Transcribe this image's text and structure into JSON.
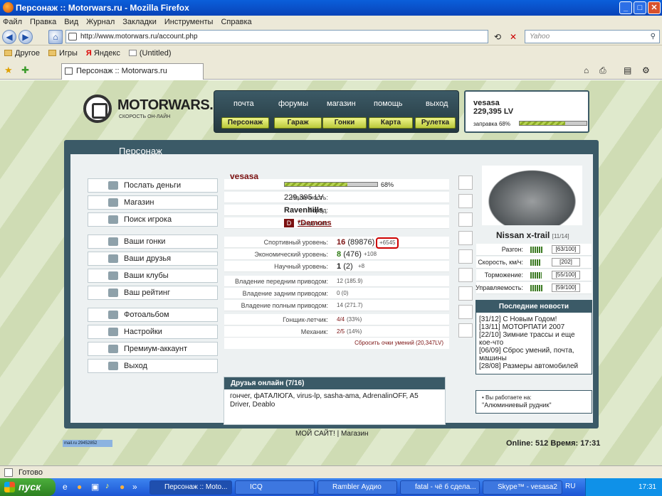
{
  "window": {
    "title": "Персонаж :: Motorwars.ru - Mozilla Firefox"
  },
  "menu": [
    "Файл",
    "Правка",
    "Вид",
    "Журнал",
    "Закладки",
    "Инструменты",
    "Справка"
  ],
  "nav": {
    "url": "http://www.motorwars.ru/account.php",
    "search_placeholder": "Yahoo"
  },
  "bookmarks": [
    "Другое",
    "Игры",
    "Яндекс",
    "(Untitled)"
  ],
  "tab": {
    "label": "Персонаж :: Motorwars.ru"
  },
  "site": {
    "logo": "MOTORWARS.RU",
    "logo_sub": "СКОРОСТЬ ОН-ЛАЙН",
    "top_links": [
      "почта",
      "форумы",
      "магазин",
      "помощь",
      "выход"
    ],
    "top_buttons": [
      "Персонаж",
      "Гараж",
      "Гонки",
      "Карта",
      "Рулетка"
    ],
    "user": {
      "name": "vesasa",
      "money": "229,395 LV",
      "fuel_label": "заправка 68%",
      "fuel_pct": 68
    },
    "section_title": "Персонаж",
    "menu": [
      "Послать деньги",
      "Магазин",
      "Поиск игрока",
      "Ваши гонки",
      "Ваши друзья",
      "Ваши клубы",
      "Ваш рейтинг",
      "Фотоальбом",
      "Настройки",
      "Премиум-аккаунт",
      "Выход"
    ],
    "char_name": "vesasa",
    "rows": {
      "fuel_label": "Заправка:",
      "fuel_val": "68%",
      "cash_label": "Наличность:",
      "cash_val": "229,395 LV",
      "city_label": "Город:",
      "city_val": "Ravenhills",
      "synd_label": "Синдикат:",
      "synd_val": "*Demons",
      "sport_label": "Спортивный уровень:",
      "sport_lvl": "16",
      "sport_pts": "(89876)",
      "sport_add": "+6545",
      "eco_label": "Экономический уровень:",
      "eco_lvl": "8",
      "eco_pts": "(476)",
      "eco_add": "+108",
      "sci_label": "Научный уровень:",
      "sci_lvl": "1",
      "sci_pts": "(2)",
      "sci_add": "+8",
      "fwd_label": "Владение передним приводом:",
      "fwd_val": "12 (185.9)",
      "rwd_label": "Владение задним приводом:",
      "rwd_val": "0 (0)",
      "awd_label": "Владение полным приводом:",
      "awd_val": "14 (271.7)",
      "pilot_label": "Гонщик-летчик:",
      "pilot_val": "4/4",
      "pilot_pct": "(33%)",
      "mech_label": "Механик:",
      "mech_val": "2/5",
      "mech_pct": "(14%)",
      "reset": "Сбросить очки умений (20,347LV)"
    },
    "car": {
      "name": "Nissan x-trail",
      "slot": "[11/14]",
      "specs": [
        {
          "label": "Разгон:",
          "value": "[63/100]",
          "level": 0.63
        },
        {
          "label": "Скорость, км/ч:",
          "value": "[202]",
          "level": 0.5
        },
        {
          "label": "Торможение:",
          "value": "[55/100]",
          "level": 0.55
        },
        {
          "label": "Управляемость:",
          "value": "[59/100]",
          "level": 0.59
        }
      ]
    },
    "news": {
      "title": "Последние новости",
      "items": [
        "[31/12] С Новым Годом!",
        "[13/11] МОТОРПАТИ 2007",
        "[22/10] Зимние трассы и еще кое-что",
        "[06/09] Сброс умений, почта, машины",
        "[28/08] Размеры автомобилей"
      ]
    },
    "friends": {
      "title": "Друзья онлайн (7/16)",
      "list": "гончеr, фАТАЛЮГА, virus-lp, sasha-ama, AdrenalinOFF, A5 Driver, Deablo"
    },
    "work": {
      "label": "Вы работаете на:",
      "place": "\"Алюминиевый рудник\""
    },
    "footer": "МОЙ САЙТ! | Магазин",
    "online": "Online: 512  Время: 17:31",
    "counter": "mail.ru 29452852"
  },
  "status": "Готово",
  "taskbar": {
    "start": "пуск",
    "items": [
      "Персонаж :: Moto...",
      "ICQ",
      "Rambler Аудио",
      "fatal - чё б сдела...",
      "Skype™ - vesasa2"
    ],
    "lang": "RU",
    "time": "17:31"
  }
}
